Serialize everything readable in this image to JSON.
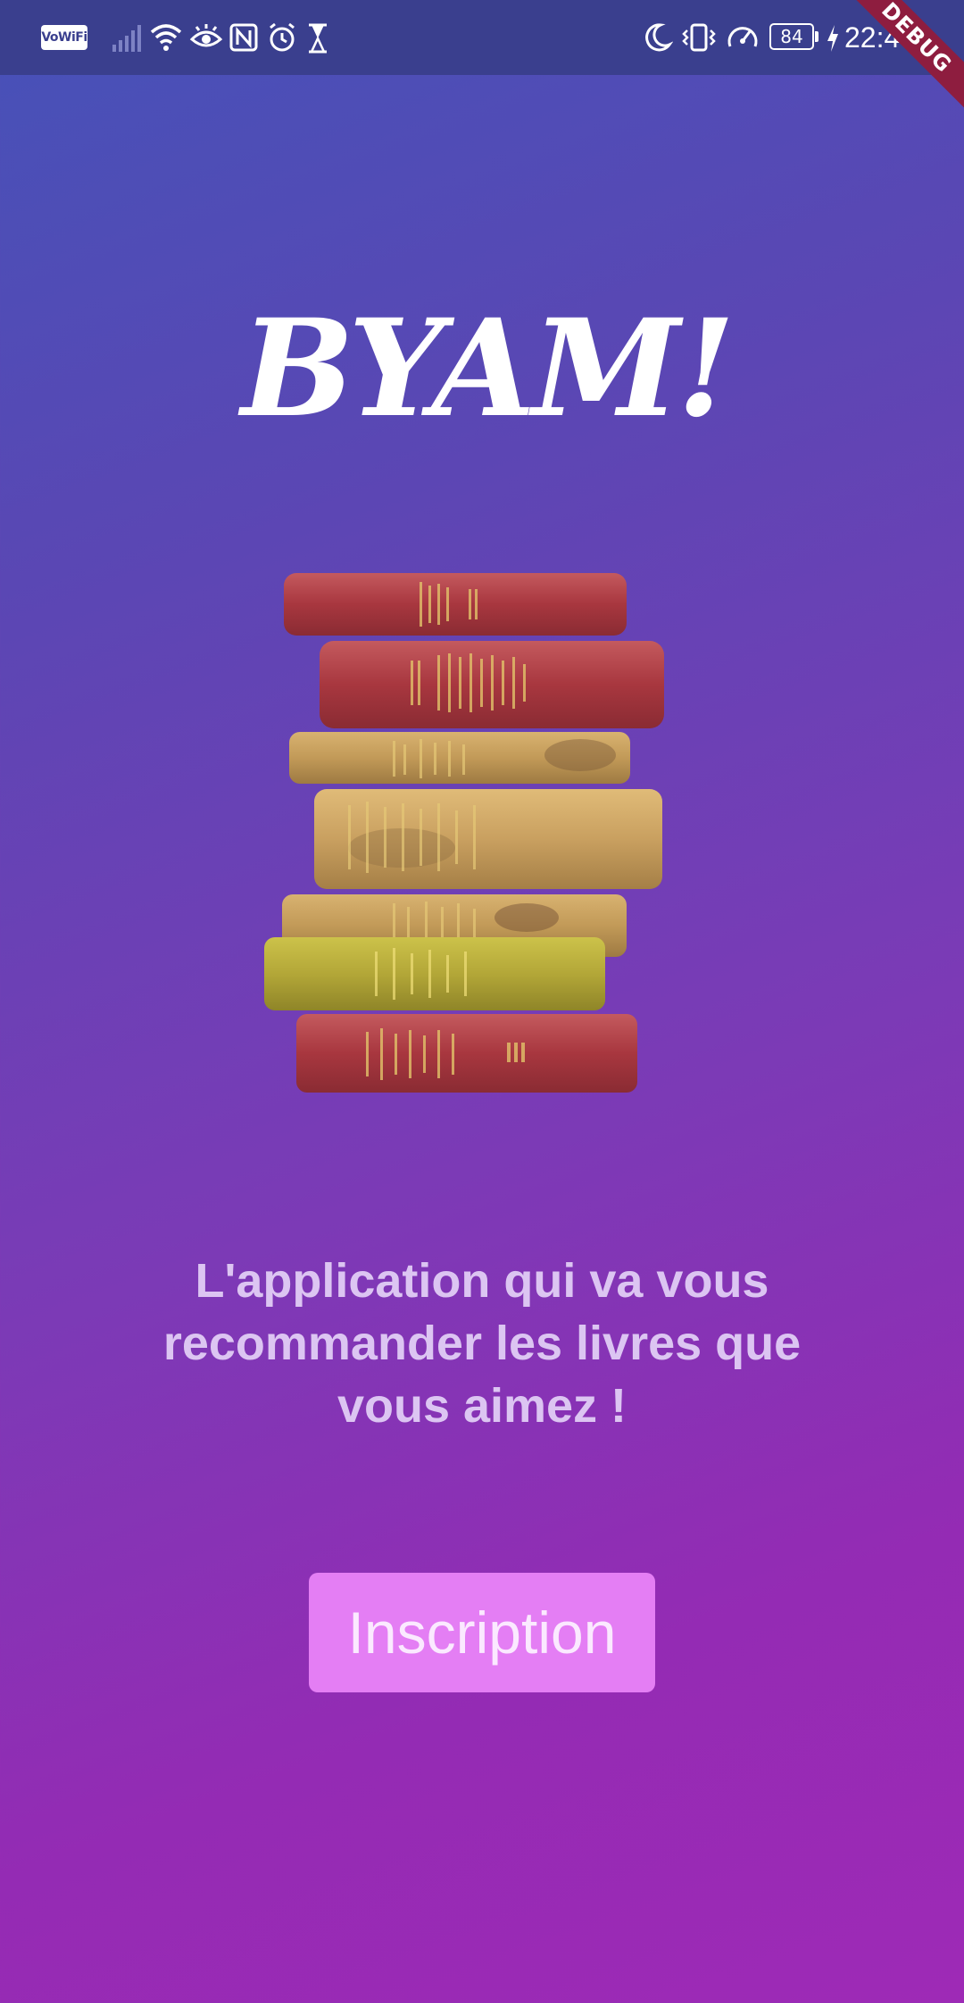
{
  "status_bar": {
    "vowifi": "VoWiFi",
    "battery_level": "84",
    "time": "22:49",
    "icons": [
      "vowifi-icon",
      "signal-icon",
      "wifi-icon",
      "eye-comfort-icon",
      "nfc-icon",
      "alarm-icon",
      "hourglass-icon",
      "do-not-disturb-icon",
      "vibrate-icon",
      "speedometer-icon",
      "battery-icon",
      "charging-icon"
    ]
  },
  "debug_banner": "DEBUG",
  "app": {
    "logo_text": "BYAM!",
    "tagline": "L'application qui va vous recommander les livres que vous aimez !",
    "signup_button_label": "Inscription"
  },
  "colors": {
    "background_top": "#4652b8",
    "background_bottom": "#9e2ab6",
    "button_bg": "#e47ef4",
    "button_text": "#fbe9ff",
    "tagline": "#dcc5f2",
    "debug_banner": "#8e1d3f"
  }
}
